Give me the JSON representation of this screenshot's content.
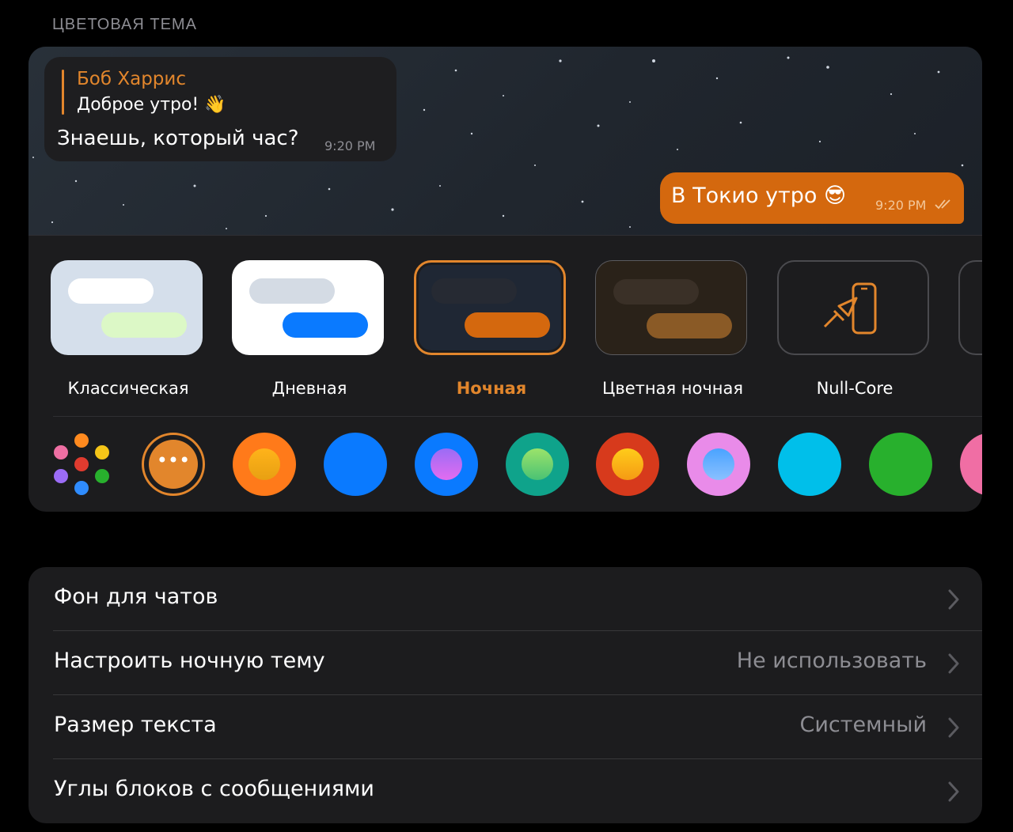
{
  "section_title": "ЦВЕТОВАЯ ТЕМА",
  "preview": {
    "incoming": {
      "reply_name": "Боб Харрис",
      "reply_text": "Доброе утро! 👋",
      "text": "Знаешь, который час?",
      "time": "9:20 PM"
    },
    "outgoing": {
      "text": "В Токио утро 😎",
      "time": "9:20 PM"
    }
  },
  "themes": [
    {
      "label": "Классическая",
      "bg": "#d5dfeb",
      "in": "#ffffff",
      "out": "#dcf8c6"
    },
    {
      "label": "Дневная",
      "bg": "#ffffff",
      "in": "#d4dbe4",
      "out": "#0a7aff"
    },
    {
      "label": "Ночная",
      "bg": "#1f2734",
      "in": "#262a33",
      "out": "#d4680e",
      "selected": true
    },
    {
      "label": "Цветная ночная",
      "bg": "#2a2219",
      "in": "#3a3027",
      "out": "#8a5a26"
    },
    {
      "label": "Null-Core",
      "icon": "brush-phone-icon"
    }
  ],
  "accent_colors": [
    "#ff8a1f",
    "#0a7aff",
    "#0a7aff",
    "#0fa38b",
    "#d73a1c",
    "#e98be9",
    "#00bfea",
    "#28b02d",
    "#f06ea4"
  ],
  "settings": [
    {
      "label": "Фон для чатов",
      "value": ""
    },
    {
      "label": "Настроить ночную тему",
      "value": "Не использовать"
    },
    {
      "label": "Размер текста",
      "value": "Системный"
    },
    {
      "label": "Углы блоков с сообщениями",
      "value": ""
    }
  ]
}
